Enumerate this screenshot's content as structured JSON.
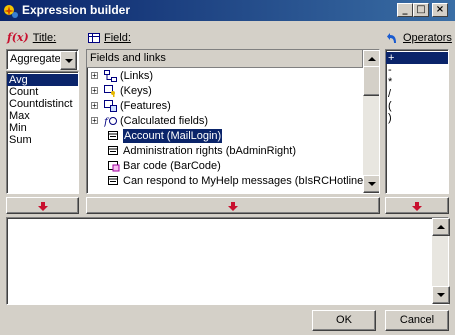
{
  "window": {
    "title": "Expression builder",
    "controls": {
      "minimize": "_",
      "maximize": "□",
      "close": "×"
    }
  },
  "title_section": {
    "label": "Title:",
    "dropdown_value": "Aggregate",
    "items": [
      "Avg",
      "Count",
      "Countdistinct",
      "Max",
      "Min",
      "Sum"
    ],
    "selected_index": 0
  },
  "field_section": {
    "label": "Field:",
    "column_header": "Fields and links",
    "tree": [
      {
        "label": "(Links)",
        "icon": "links-icon"
      },
      {
        "label": "(Keys)",
        "icon": "keys-icon"
      },
      {
        "label": "(Features)",
        "icon": "features-icon"
      },
      {
        "label": "(Calculated fields)",
        "icon": "calculated-fields-icon"
      },
      {
        "label": "Account (MailLogin)",
        "icon": "field-icon"
      },
      {
        "label": "Administration rights (bAdminRight)",
        "icon": "field-icon"
      },
      {
        "label": "Bar code (BarCode)",
        "icon": "barcode-icon"
      },
      {
        "label": "Can respond to MyHelp messages (bIsRCHotliner)",
        "icon": "field-icon"
      }
    ],
    "selected_index": 4
  },
  "operators_section": {
    "label": "Operators",
    "items": [
      "+",
      "-",
      "*",
      "/",
      "(",
      ")"
    ],
    "selected_index": 0
  },
  "buttons": {
    "ok": "OK",
    "cancel": "Cancel"
  },
  "colors": {
    "selection": "#0a246a",
    "arrow": "#c8102e",
    "face": "#d4d0c8"
  }
}
